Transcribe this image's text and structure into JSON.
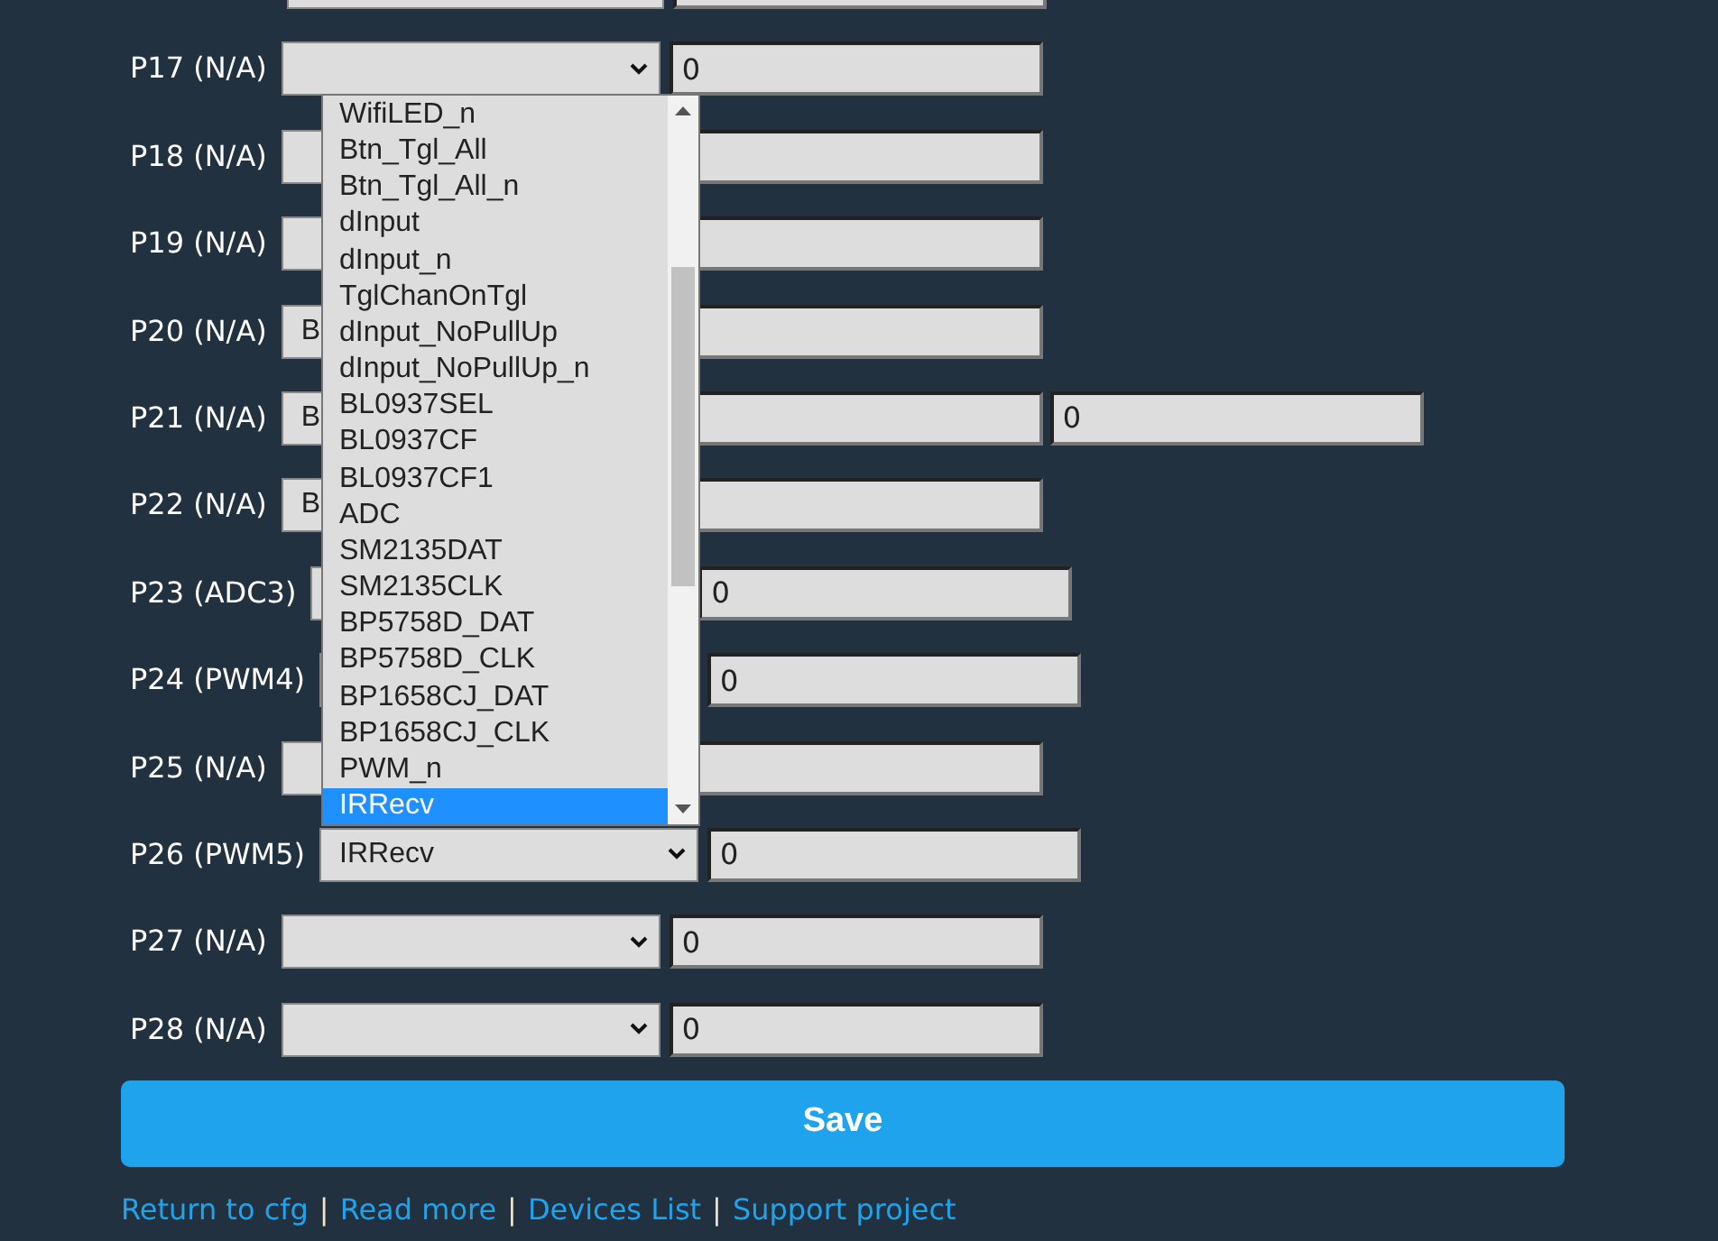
{
  "pins": [
    {
      "label": "P17 (N/A)",
      "value": "0"
    },
    {
      "label": "P18 (N/A)",
      "covered_by_list": true
    },
    {
      "label": "P19 (N/A)",
      "covered_by_list": true
    },
    {
      "label": "P20 (N/A)",
      "select_value": "B",
      "covered_by_list": true
    },
    {
      "label": "P21 (N/A)",
      "select_value": "B",
      "extra_value": "0",
      "covered_by_list": true
    },
    {
      "label": "P22 (N/A)",
      "select_value": "B",
      "covered_by_list": true
    },
    {
      "label": "P23 (ADC3)",
      "value": "0"
    },
    {
      "label": "P24 (PWM4)",
      "value": "0"
    },
    {
      "label": "P25 (N/A)",
      "covered_by_list": true
    },
    {
      "label": "P26 (PWM5)",
      "select_value": "IRRecv",
      "value": "0"
    },
    {
      "label": "P27 (N/A)",
      "value": "0"
    },
    {
      "label": "P28 (N/A)",
      "value": "0"
    }
  ],
  "dropdown": {
    "options": [
      {
        "label": "WifiLED_n",
        "selected": false
      },
      {
        "label": "Btn_Tgl_All",
        "selected": false
      },
      {
        "label": "Btn_Tgl_All_n",
        "selected": false
      },
      {
        "label": "dInput",
        "selected": false
      },
      {
        "label": "dInput_n",
        "selected": false
      },
      {
        "label": "TglChanOnTgl",
        "selected": false
      },
      {
        "label": "dInput_NoPullUp",
        "selected": false
      },
      {
        "label": "dInput_NoPullUp_n",
        "selected": false
      },
      {
        "label": "BL0937SEL",
        "selected": false
      },
      {
        "label": "BL0937CF",
        "selected": false
      },
      {
        "label": "BL0937CF1",
        "selected": false
      },
      {
        "label": "ADC",
        "selected": false
      },
      {
        "label": "SM2135DAT",
        "selected": false
      },
      {
        "label": "SM2135CLK",
        "selected": false
      },
      {
        "label": "BP5758D_DAT",
        "selected": false
      },
      {
        "label": "BP5758D_CLK",
        "selected": false
      },
      {
        "label": "BP1658CJ_DAT",
        "selected": false
      },
      {
        "label": "BP1658CJ_CLK",
        "selected": false
      },
      {
        "label": "PWM_n",
        "selected": false
      },
      {
        "label": "IRRecv",
        "selected": true
      }
    ]
  },
  "save_button": "Save",
  "links": [
    "Return to cfg",
    "Read more",
    "Devices List",
    "Support project"
  ],
  "separator": "|"
}
